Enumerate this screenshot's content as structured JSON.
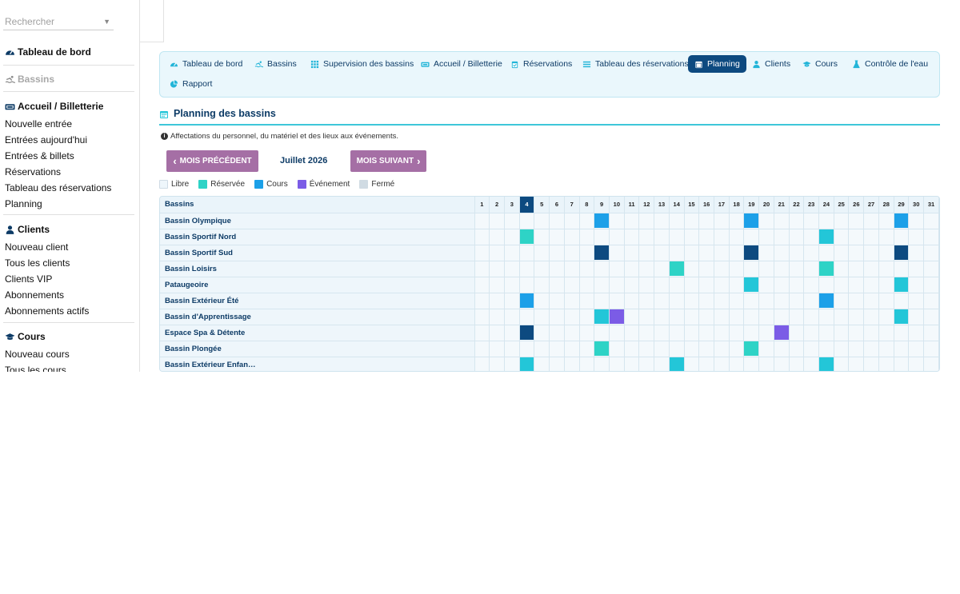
{
  "search": {
    "placeholder": "Rechercher"
  },
  "sidebar": {
    "sections": [
      {
        "title": "Tableau de bord",
        "icon": "dashboard-icon",
        "items": []
      },
      {
        "title": "Bassins",
        "icon": "swimmer-icon",
        "muted": true,
        "items": []
      },
      {
        "title": "Accueil / Billetterie",
        "icon": "ticket-icon",
        "items": [
          "Nouvelle entrée",
          "Entrées aujourd'hui",
          "Entrées & billets",
          "Réservations",
          "Tableau des réservations",
          "Planning"
        ]
      },
      {
        "title": "Clients",
        "icon": "user-icon",
        "items": [
          "Nouveau client",
          "Tous les clients",
          "Clients VIP",
          "Abonnements",
          "Abonnements actifs"
        ]
      },
      {
        "title": "Cours",
        "icon": "graduation-cap-icon",
        "items": [
          "Nouveau cours",
          "Tous les cours"
        ]
      }
    ]
  },
  "nav": {
    "tabs": [
      {
        "label": "Tableau de bord",
        "icon": "dashboard-icon"
      },
      {
        "label": "Bassins",
        "icon": "swimmer-icon"
      },
      {
        "label": "Supervision des bassins",
        "icon": "grid-icon"
      },
      {
        "label": "Accueil / Billetterie",
        "icon": "ticket-icon"
      },
      {
        "label": "Réservations",
        "icon": "calendar-check-icon"
      },
      {
        "label": "Tableau des réservations",
        "icon": "list-icon"
      },
      {
        "label": "Planning",
        "icon": "calendar-icon",
        "active": true
      },
      {
        "label": "Clients",
        "icon": "user-icon"
      },
      {
        "label": "Cours",
        "icon": "graduation-cap-icon"
      },
      {
        "label": "Contrôle de l'eau",
        "icon": "flask-icon"
      },
      {
        "label": "Rapport",
        "icon": "pie-chart-icon"
      }
    ]
  },
  "page": {
    "title": "Planning des bassins",
    "info": "Affectations du personnel, du matériel et des lieux aux événements.",
    "prev_label": "MOIS PRÉCÉDENT",
    "next_label": "MOIS SUIVANT",
    "month": "Juillet 2026"
  },
  "legend": [
    {
      "label": "Libre",
      "color": "#eef6fb"
    },
    {
      "label": "Réservée",
      "color": "#2ed3c6"
    },
    {
      "label": "Cours",
      "color": "#1ca0e8"
    },
    {
      "label": "Événement",
      "color": "#7b5ce6"
    },
    {
      "label": "Fermé",
      "color": "#d0dbe3"
    }
  ],
  "colors": {
    "reservee": "#2ed3c6",
    "reservee_alt": "#23c6d8",
    "cours": "#1ca0e8",
    "cours_dark": "#0d4a80",
    "evenement": "#7b5ce6",
    "accent": "#0d4a80"
  },
  "schedule": {
    "header": "Bassins",
    "days": 31,
    "today": 4,
    "rows": [
      {
        "name": "Bassin Olympique",
        "marks": {
          "9": "cours",
          "19": "cours",
          "29": "cours"
        }
      },
      {
        "name": "Bassin Sportif Nord",
        "marks": {
          "4": "reservee",
          "24": "reservee_alt"
        }
      },
      {
        "name": "Bassin Sportif Sud",
        "marks": {
          "9": "cours_dark",
          "19": "cours_dark",
          "29": "cours_dark"
        }
      },
      {
        "name": "Bassin Loisirs",
        "marks": {
          "14": "reservee",
          "24": "reservee"
        }
      },
      {
        "name": "Pataugeoire",
        "marks": {
          "19": "reservee_alt",
          "29": "reservee_alt"
        }
      },
      {
        "name": "Bassin Extérieur Été",
        "marks": {
          "4": "cours",
          "24": "cours"
        }
      },
      {
        "name": "Bassin d'Apprentissage",
        "marks": {
          "9": "reservee_alt",
          "10": "evenement",
          "29": "reservee_alt"
        }
      },
      {
        "name": "Espace Spa & Détente",
        "marks": {
          "4": "cours_dark",
          "21": "evenement"
        }
      },
      {
        "name": "Bassin Plongée",
        "marks": {
          "9": "reservee",
          "19": "reservee"
        }
      },
      {
        "name": "Bassin Extérieur Enfan…",
        "marks": {
          "4": "reservee_alt",
          "14": "reservee_alt",
          "24": "reservee_alt"
        }
      }
    ]
  }
}
